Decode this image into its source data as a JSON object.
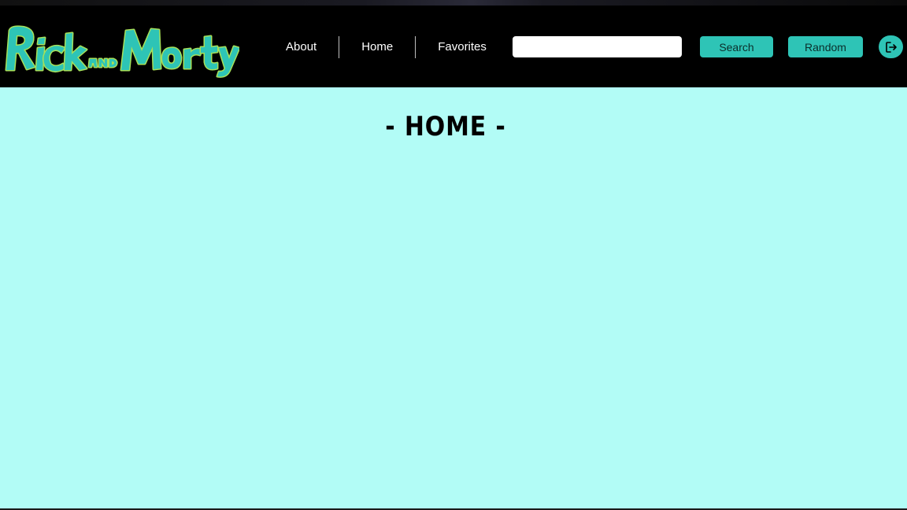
{
  "brand": {
    "logo_text": "Rick and Morty",
    "logo_color": "#2ec4b6",
    "logo_outline": "#a6e05a"
  },
  "nav": {
    "items": [
      {
        "label": "About"
      },
      {
        "label": "Home"
      },
      {
        "label": "Favorites"
      }
    ]
  },
  "search": {
    "value": "",
    "placeholder": "",
    "button_label": "Search"
  },
  "random": {
    "button_label": "Random"
  },
  "logout": {
    "icon": "logout-icon"
  },
  "main": {
    "title": "- HOME -",
    "background": "#b2fcf6"
  },
  "colors": {
    "navbar": "#000000",
    "accent": "#2ec4b6"
  }
}
